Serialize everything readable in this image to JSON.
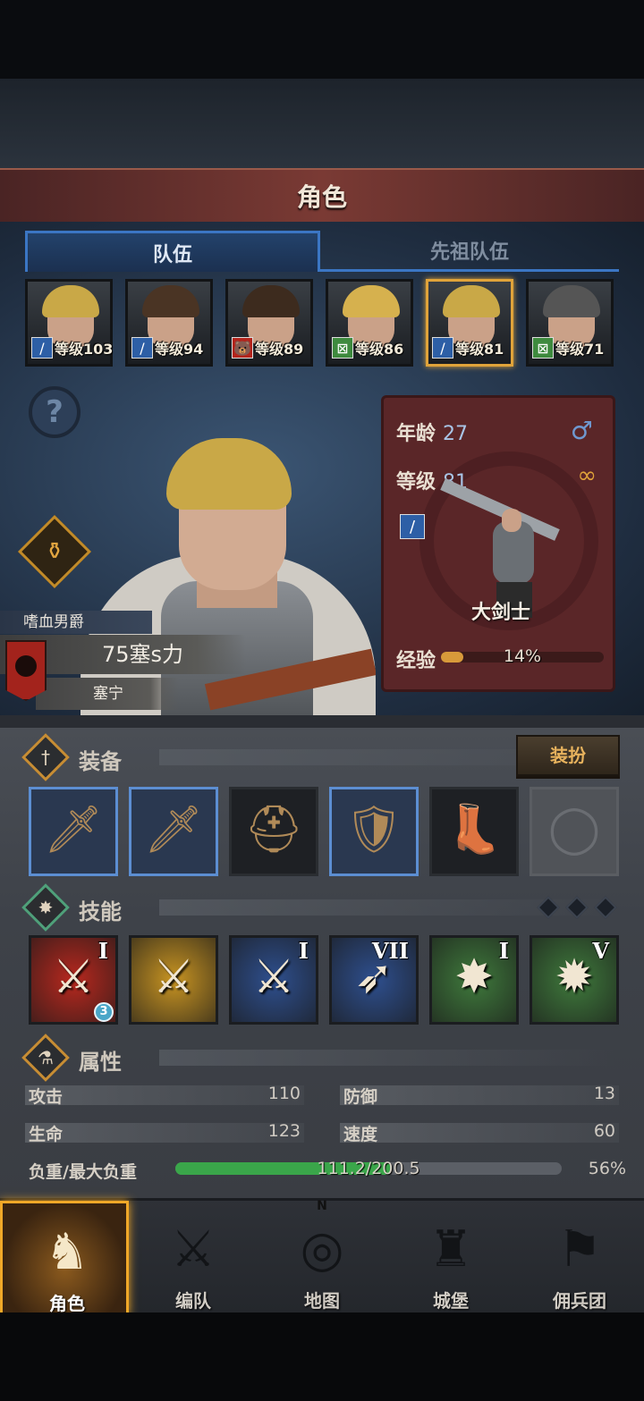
{
  "header": {
    "title": "角色"
  },
  "tabs": [
    {
      "label": "队伍",
      "active": true
    },
    {
      "label": "先祖队伍",
      "active": false
    }
  ],
  "roster": [
    {
      "level_text": "等级103",
      "class_icon": "sword-icon",
      "class_color": "#2d5fa6",
      "hair_color": "#c9a847",
      "selected": false
    },
    {
      "level_text": "等级94",
      "class_icon": "sword-icon",
      "class_color": "#2d5fa6",
      "hair_color": "#4a3424",
      "selected": false
    },
    {
      "level_text": "等级89",
      "class_icon": "bear-icon",
      "class_color": "#b3241c",
      "hair_color": "#3d2b1e",
      "selected": false
    },
    {
      "level_text": "等级86",
      "class_icon": "bow-icon",
      "class_color": "#3e8a3e",
      "hair_color": "#d6b14e",
      "selected": false
    },
    {
      "level_text": "等级81",
      "class_icon": "sword-icon",
      "class_color": "#2d5fa6",
      "hair_color": "#c9a847",
      "selected": true
    },
    {
      "level_text": "等级71",
      "class_icon": "bow-icon",
      "class_color": "#3e8a3e",
      "hair_color": "#555555",
      "selected": false
    }
  ],
  "hero": {
    "title": "嗜血男爵",
    "power": "75塞s力",
    "home": "塞宁",
    "age_label": "年龄",
    "age": "27",
    "level_label": "等级",
    "level": "81",
    "class_name": "大剑士",
    "exp_label": "经验",
    "exp_pct_text": "14%",
    "exp_fraction": 0.14
  },
  "equipment": {
    "label": "装备",
    "dress_button": "装扮",
    "slots": [
      {
        "name": "greatsword-icon",
        "glyph": "🗡",
        "rarity": "blue"
      },
      {
        "name": "greatsword-icon",
        "glyph": "🗡",
        "rarity": "blue"
      },
      {
        "name": "helmet-icon",
        "glyph": "⛑",
        "rarity": "normal"
      },
      {
        "name": "chest-armor-icon",
        "glyph": "🛡",
        "rarity": "blue"
      },
      {
        "name": "boots-icon",
        "glyph": "👢",
        "rarity": "normal"
      },
      {
        "name": "ring-slot-empty-icon",
        "glyph": "◯",
        "rarity": "empty"
      }
    ]
  },
  "skills": {
    "label": "技能",
    "items": [
      {
        "name": "skill-break-icon",
        "glyph": "⚔",
        "rank": "I",
        "bg": "#b8281e",
        "badge": "3"
      },
      {
        "name": "skill-rally-icon",
        "glyph": "⚔",
        "rank": "",
        "bg": "#c89422",
        "badge": ""
      },
      {
        "name": "skill-crystal-strike-icon",
        "glyph": "⚔",
        "rank": "I",
        "bg": "#2e4f8e",
        "badge": ""
      },
      {
        "name": "skill-charge-icon",
        "glyph": "➶",
        "rank": "VII",
        "bg": "#2e4f8e",
        "badge": ""
      },
      {
        "name": "skill-burst-icon",
        "glyph": "✸",
        "rank": "I",
        "bg": "#3f7a3c",
        "badge": ""
      },
      {
        "name": "skill-explosion-icon",
        "glyph": "✹",
        "rank": "V",
        "bg": "#3f7a3c",
        "badge": ""
      }
    ]
  },
  "attributes": {
    "label": "属性",
    "attack_label": "攻击",
    "attack": "110",
    "defense_label": "防御",
    "defense": "13",
    "hp_label": "生命",
    "hp": "123",
    "speed_label": "速度",
    "speed": "60",
    "load_label": "负重/最大负重",
    "load_text": "111.2/200.5",
    "load_pct_text": "56%",
    "load_fraction": 0.56
  },
  "nav": [
    {
      "label": "角色",
      "icon": "knight-icon",
      "glyph": "♞",
      "active": true
    },
    {
      "label": "编队",
      "icon": "formation-helmet-icon",
      "glyph": "⚔",
      "active": false
    },
    {
      "label": "地图",
      "icon": "compass-icon",
      "glyph": "◎",
      "active": false
    },
    {
      "label": "城堡",
      "icon": "castle-icon",
      "glyph": "♜",
      "active": false
    },
    {
      "label": "佣兵团",
      "icon": "mercenary-icon",
      "glyph": "⚑",
      "active": false
    }
  ]
}
